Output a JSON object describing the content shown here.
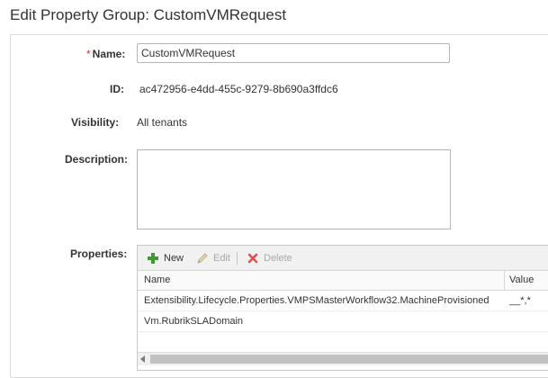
{
  "page": {
    "title": "Edit Property Group: CustomVMRequest"
  },
  "form": {
    "name": {
      "required_mark": "*",
      "label": "Name:",
      "value": "CustomVMRequest"
    },
    "id": {
      "label": "ID:",
      "value": "ac472956-e4dd-455c-9279-8b690a3ffdc6"
    },
    "visibility": {
      "label": "Visibility:",
      "value": "All tenants"
    },
    "description": {
      "label": "Description:",
      "value": ""
    },
    "properties": {
      "label": "Properties:"
    }
  },
  "properties_grid": {
    "toolbar": {
      "new_label": "New",
      "edit_label": "Edit",
      "delete_label": "Delete"
    },
    "columns": [
      "Name",
      "Value"
    ],
    "rows": [
      {
        "name": "Extensibility.Lifecycle.Properties.VMPSMasterWorkflow32.MachineProvisioned",
        "value": "__*,*"
      },
      {
        "name": "Vm.RubrikSLADomain",
        "value": ""
      }
    ]
  },
  "icons": {
    "new": "plus-icon",
    "edit": "pencil-icon",
    "delete": "x-icon"
  },
  "colors": {
    "new_icon": "#3d9a2f",
    "delete_icon": "#d9534f",
    "required_star": "#cc3333"
  }
}
